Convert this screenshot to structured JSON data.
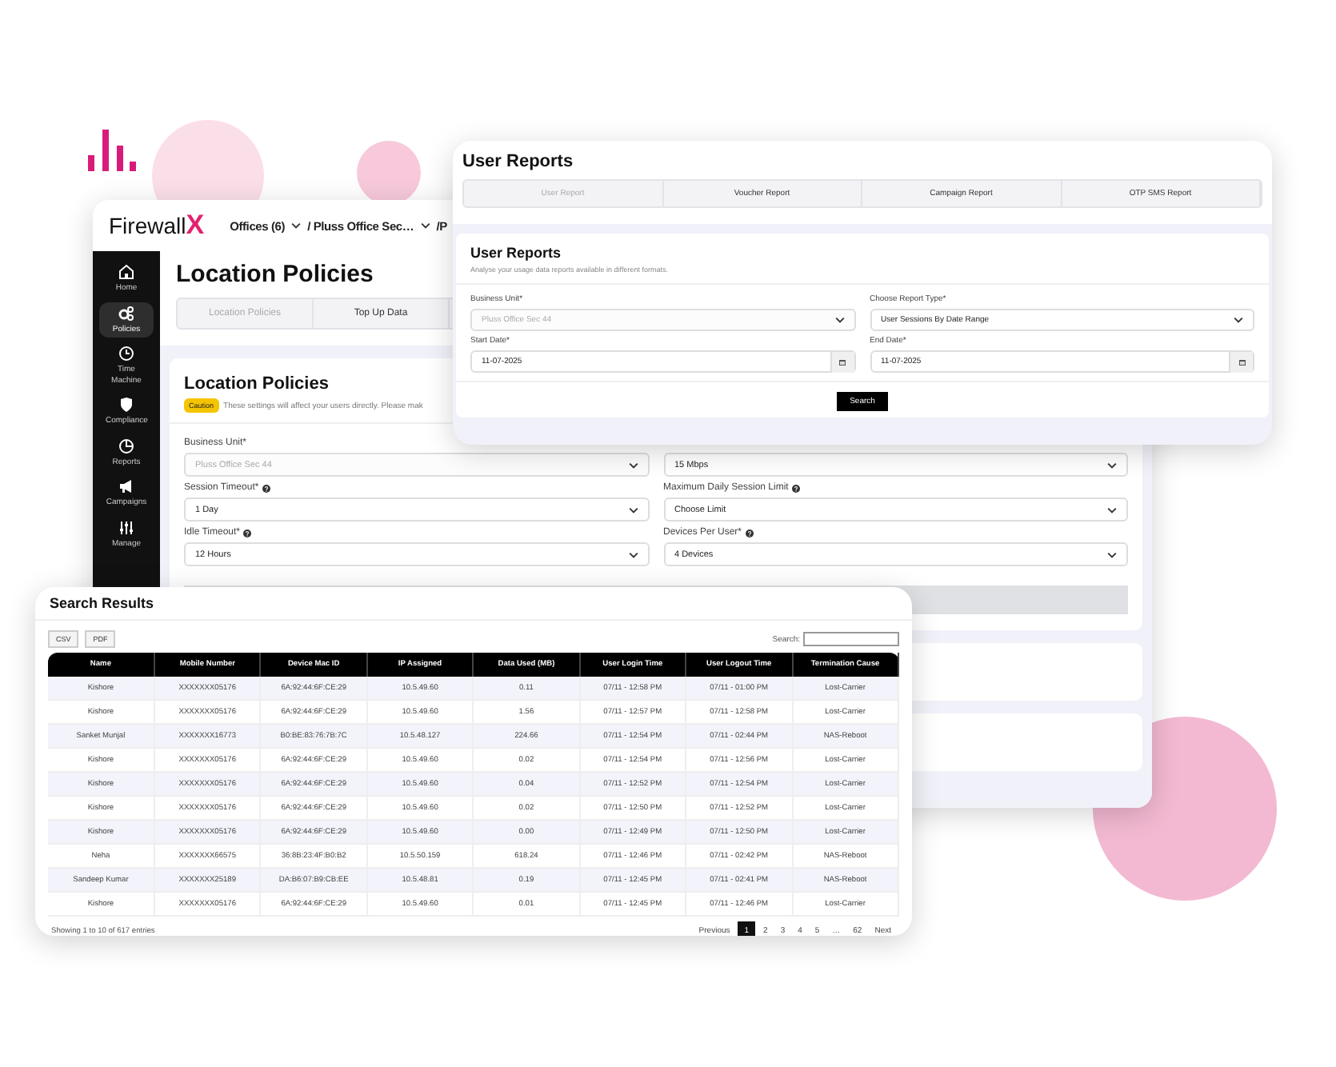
{
  "app": {
    "logo": {
      "word": "Firewall",
      "mark": "X"
    },
    "breadcrumb": [
      {
        "label": "Offices (6)",
        "dropdown": true
      },
      {
        "label": "/ Pluss Office Sec…",
        "dropdown": true
      },
      {
        "label": "/P"
      }
    ],
    "sidebar": {
      "items": [
        {
          "label": "Home",
          "selected": false
        },
        {
          "label": "Policies",
          "selected": true
        },
        {
          "label": "Time Machine",
          "selected": false
        },
        {
          "label": "Compliance",
          "selected": false
        },
        {
          "label": "Reports",
          "selected": false
        },
        {
          "label": "Campaigns",
          "selected": false
        },
        {
          "label": "Manage",
          "selected": false
        }
      ]
    },
    "page_title": "Location Policies",
    "tabs": [
      {
        "label": "Location Policies",
        "selected": true
      },
      {
        "label": "Top Up Data",
        "selected": false
      }
    ],
    "card": {
      "title": "Location Policies",
      "badge": "Caution",
      "note": "These settings will affect your users directly. Please mak",
      "fields": [
        {
          "label": "Business Unit*",
          "value": "Pluss Office Sec 44",
          "kind": "select",
          "disabled": true
        },
        {
          "value": "15 Mbps",
          "kind": "select",
          "disabled": false
        },
        {
          "label": "Session Timeout*",
          "help": true,
          "value": "1 Day",
          "kind": "select",
          "disabled": false
        },
        {
          "label": "Maximum Daily Session Limit",
          "help": true,
          "value": "Choose Limit",
          "kind": "select",
          "disabled": false
        },
        {
          "label": "Idle Timeout*",
          "help": true,
          "value": "12 Hours",
          "kind": "select",
          "disabled": false
        },
        {
          "label": "Devices Per User*",
          "help": true,
          "value": "4 Devices",
          "kind": "select",
          "disabled": false
        }
      ]
    }
  },
  "user_reports": {
    "title": "User Reports",
    "tabs": [
      {
        "label": "User Report",
        "selected": true
      },
      {
        "label": "Voucher Report",
        "selected": false
      },
      {
        "label": "Campaign Report",
        "selected": false
      },
      {
        "label": "OTP SMS Report",
        "selected": false
      }
    ],
    "card": {
      "title": "User Reports",
      "subtitle": "Analyse your usage data reports available in different formats.",
      "fields": [
        {
          "label": "Business Unit*",
          "value": "Pluss Office Sec 44",
          "kind": "select",
          "disabled": true
        },
        {
          "label": "Choose Report Type*",
          "value": "User Sessions By Date Range",
          "kind": "select",
          "disabled": false
        },
        {
          "label": "Start Date*",
          "value": "11-07-2025",
          "kind": "date",
          "disabled": false
        },
        {
          "label": "End Date*",
          "value": "11-07-2025",
          "kind": "date",
          "disabled": false
        }
      ],
      "button": "Search"
    }
  },
  "search_results": {
    "title": "Search Results",
    "exports": [
      "CSV",
      "PDF"
    ],
    "search_label": "Search:",
    "table": {
      "columns": [
        "Name",
        "Mobile Number",
        "Device Mac ID",
        "IP Assigned",
        "Data Used (MB)",
        "User Login Time",
        "User Logout Time",
        "Termination Cause"
      ],
      "rows": [
        [
          "Kishore",
          "XXXXXXX05176",
          "6A:92:44:6F:CE:29",
          "10.5.49.60",
          "0.11",
          "07/11 - 12:58 PM",
          "07/11 - 01:00 PM",
          "Lost-Carrier"
        ],
        [
          "Kishore",
          "XXXXXXX05176",
          "6A:92:44:6F:CE:29",
          "10.5.49.60",
          "1.56",
          "07/11 - 12:57 PM",
          "07/11 - 12:58 PM",
          "Lost-Carrier"
        ],
        [
          "Sanket Munjal",
          "XXXXXXX16773",
          "B0:BE:83:76:7B:7C",
          "10.5.48.127",
          "224.66",
          "07/11 - 12:54 PM",
          "07/11 - 02:44 PM",
          "NAS-Reboot"
        ],
        [
          "Kishore",
          "XXXXXXX05176",
          "6A:92:44:6F:CE:29",
          "10.5.49.60",
          "0.02",
          "07/11 - 12:54 PM",
          "07/11 - 12:56 PM",
          "Lost-Carrier"
        ],
        [
          "Kishore",
          "XXXXXXX05176",
          "6A:92:44:6F:CE:29",
          "10.5.49.60",
          "0.04",
          "07/11 - 12:52 PM",
          "07/11 - 12:54 PM",
          "Lost-Carrier"
        ],
        [
          "Kishore",
          "XXXXXXX05176",
          "6A:92:44:6F:CE:29",
          "10.5.49.60",
          "0.02",
          "07/11 - 12:50 PM",
          "07/11 - 12:52 PM",
          "Lost-Carrier"
        ],
        [
          "Kishore",
          "XXXXXXX05176",
          "6A:92:44:6F:CE:29",
          "10.5.49.60",
          "0.00",
          "07/11 - 12:49 PM",
          "07/11 - 12:50 PM",
          "Lost-Carrier"
        ],
        [
          "Neha",
          "XXXXXXX66575",
          "36:8B:23:4F:B0:B2",
          "10.5.50.159",
          "618.24",
          "07/11 - 12:46 PM",
          "07/11 - 02:42 PM",
          "NAS-Reboot"
        ],
        [
          "Sandeep Kumar",
          "XXXXXXX25189",
          "DA:B6:07:B9:CB:EE",
          "10.5.48.81",
          "0.19",
          "07/11 - 12:45 PM",
          "07/11 - 02:41 PM",
          "NAS-Reboot"
        ],
        [
          "Kishore",
          "XXXXXXX05176",
          "6A:92:44:6F:CE:29",
          "10.5.49.60",
          "0.01",
          "07/11 - 12:45 PM",
          "07/11 - 12:46 PM",
          "Lost-Carrier"
        ]
      ]
    },
    "summary": "Showing 1 to 10 of 617 entries",
    "pagination": [
      {
        "label": "Previous",
        "selected": false
      },
      {
        "label": "1",
        "selected": true
      },
      {
        "label": "2",
        "selected": false
      },
      {
        "label": "3",
        "selected": false
      },
      {
        "label": "4",
        "selected": false
      },
      {
        "label": "5",
        "selected": false
      },
      {
        "label": "…",
        "selected": false
      },
      {
        "label": "62",
        "selected": false
      },
      {
        "label": "Next",
        "selected": false
      }
    ]
  }
}
